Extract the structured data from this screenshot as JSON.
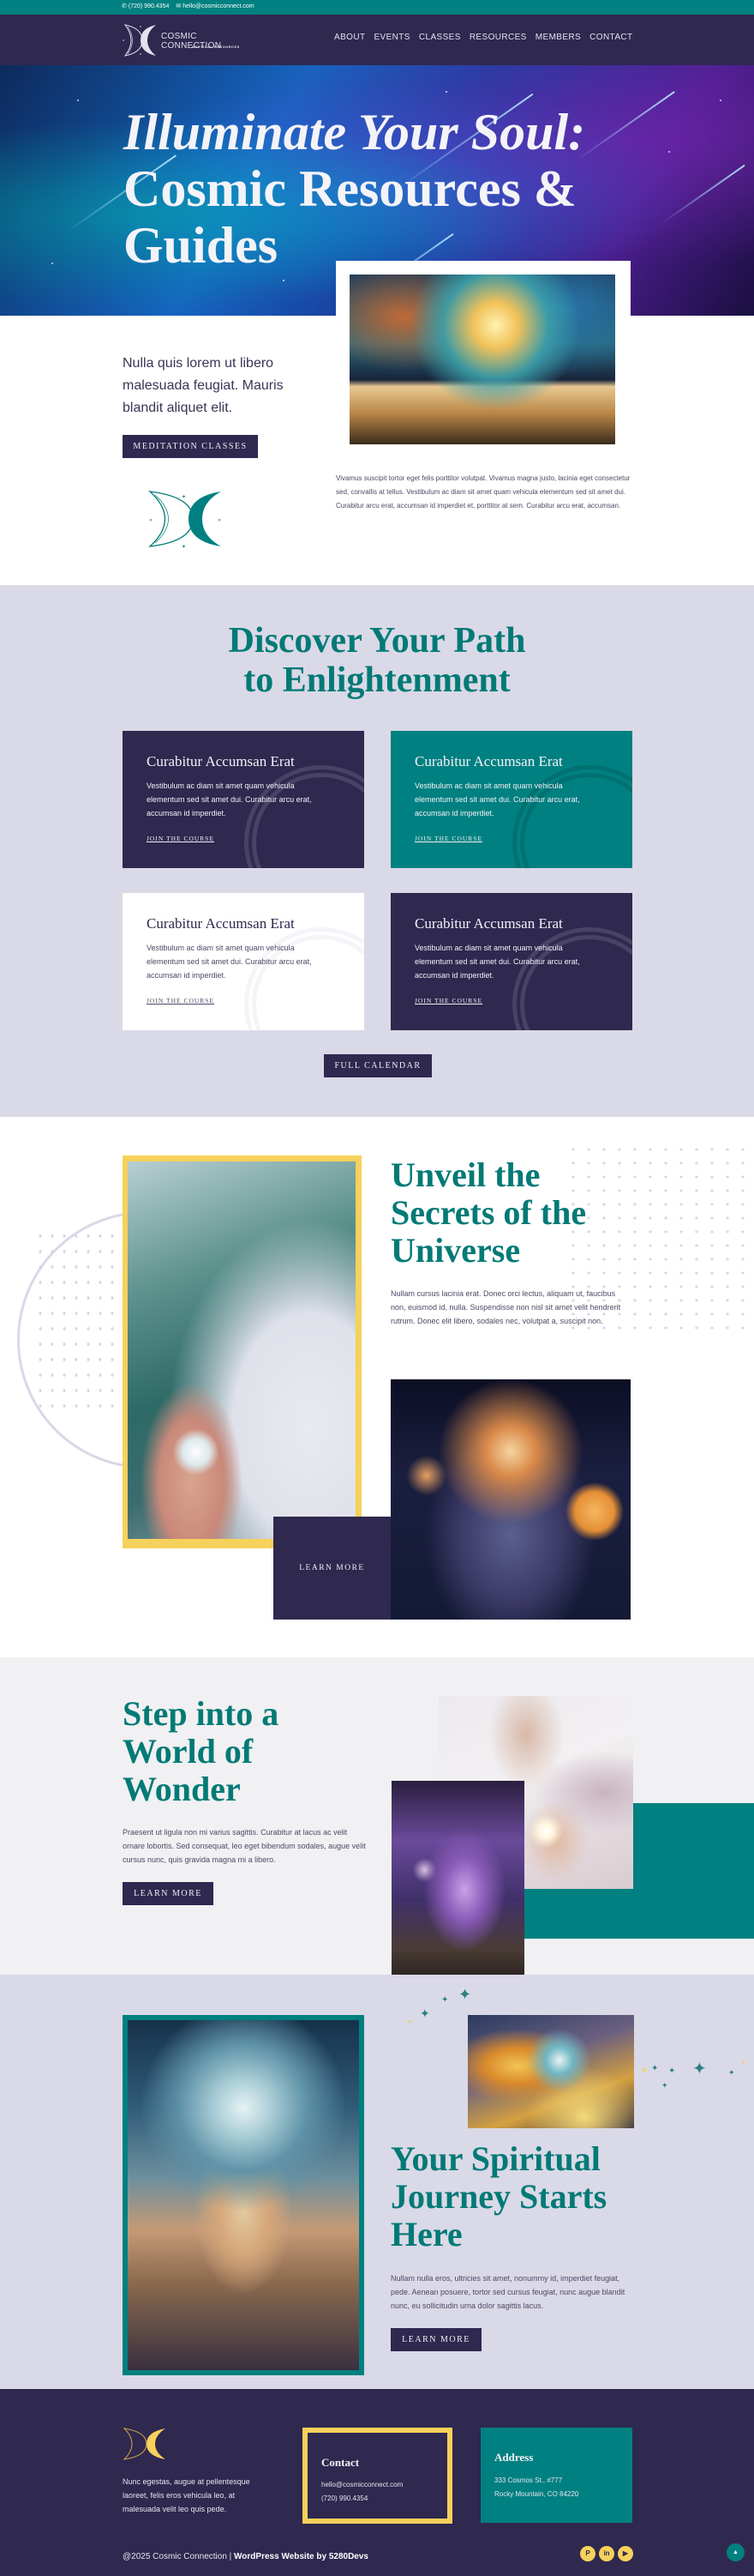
{
  "topbar": {
    "phone_icon": "phone-icon",
    "phone": "(720) 990.4354",
    "email_icon": "envelope-icon",
    "email": "hello@cosmicconnect.com"
  },
  "header": {
    "logo_title": "COSMIC CONNECTION",
    "logo_subtitle": "MYSTICAL RESOURCES",
    "nav": [
      "ABOUT",
      "EVENTS",
      "CLASSES",
      "RESOURCES",
      "MEMBERS",
      "CONTACT"
    ]
  },
  "hero": {
    "title_line1": "Illuminate Your Soul:",
    "title_line2": "Cosmic Resources &",
    "title_line3": "Guides"
  },
  "intro": {
    "lead": "Nulla quis lorem ut libero malesuada feugiat. Mauris blandit aliquet elit.",
    "button": "MEDITATION CLASSES",
    "body": "Vivamus suscipit tortor eget felis porttitor volutpat. Vivamus magna justo, lacinia eget consectetur sed, convallis at tellus. Vestibulum ac diam sit amet quam vehicula elementum sed sit amet dui. Curabitur arcu erat, accumsan id imperdiet et, porttitor at sem. Curabitur arcu erat, accumsan."
  },
  "discover": {
    "title_line1": "Discover Your Path",
    "title_line2": "to Enlightenment",
    "cards": [
      {
        "title": "Curabitur Accumsan Erat",
        "body": "Vestibulum ac diam sit amet quam vehicula elementum sed sit amet dui. Curabitur arcu erat, accumsan id imperdiet.",
        "link": "JOIN THE COURSE",
        "theme": "dark"
      },
      {
        "title": "Curabitur Accumsan Erat",
        "body": "Vestibulum ac diam sit amet quam vehicula elementum sed sit amet dui. Curabitur arcu erat, accumsan id imperdiet.",
        "link": "JOIN THE COURSE",
        "theme": "teal"
      },
      {
        "title": "Curabitur Accumsan Erat",
        "body": "Vestibulum ac diam sit amet quam vehicula elementum sed sit amet dui. Curabitur arcu erat, accumsan id imperdiet.",
        "link": "JOIN THE COURSE",
        "theme": "white"
      },
      {
        "title": "Curabitur Accumsan Erat",
        "body": "Vestibulum ac diam sit amet quam vehicula elementum sed sit amet dui. Curabitur arcu erat, accumsan id imperdiet.",
        "link": "JOIN THE COURSE",
        "theme": "dark"
      }
    ],
    "button": "FULL CALENDAR"
  },
  "unveil": {
    "title": "Unveil the Secrets of the Universe",
    "body": "Nullam cursus lacinia erat. Donec orci lectus, aliquam ut, faucibus non, euismod id, nulla. Suspendisse non nisl sit amet velit hendrerit rutrum. Donec elit libero, sodales nec, volutpat a, suscipit non.",
    "button": "LEARN MORE"
  },
  "step": {
    "title": "Step into a World of Wonder",
    "body": "Praesent ut ligula non mi varius sagittis. Curabitur at lacus ac velit ornare lobortis. Sed consequat, leo eget bibendum sodales, augue velit cursus nunc, quis gravida magna mi a libero.",
    "button": "LEARN MORE"
  },
  "journey": {
    "title": "Your Spiritual Journey Starts Here",
    "body": "Nullam nulla eros, ultricies sit amet, nonummy id, imperdiet feugiat, pede. Aenean posuere, tortor sed cursus feugiat, nunc augue blandit nunc, eu sollicitudin urna dolor sagittis lacus.",
    "button": "LEARN MORE"
  },
  "footer": {
    "about": "Nunc egestas, augue at pellentesque laoreet, felis eros vehicula leo, at malesuada velit leo quis pede.",
    "contact_title": "Contact",
    "contact_email": "hello@cosmicconnect.com",
    "contact_phone": "(720) 990.4354",
    "address_title": "Address",
    "address_line1": "333 Cosmos St., #777",
    "address_line2": "Rocky Mountain, CO 84220",
    "copyright": "@2025 Cosmic Connection | ",
    "credit": "WordPress Website by 5280Devs",
    "socials": [
      "patreon-icon",
      "linkedin-icon",
      "youtube-icon"
    ],
    "back_to_top": "back-to-top-icon"
  },
  "colors": {
    "teal": "#008080",
    "purple": "#2f284f",
    "lavender": "#dad9e7",
    "gold": "#f6d15b",
    "heading_teal": "#027a76"
  }
}
